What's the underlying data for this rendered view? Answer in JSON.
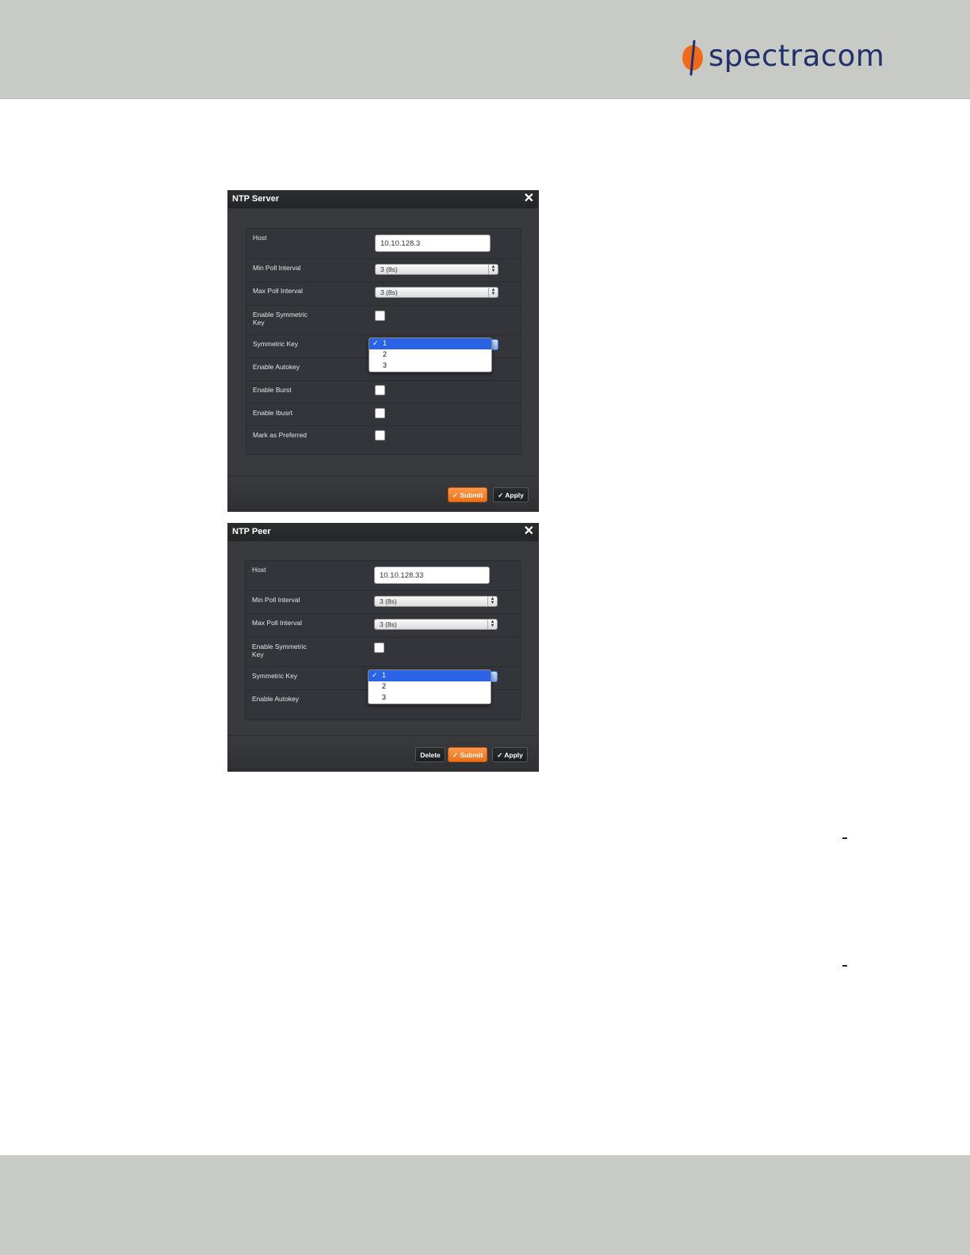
{
  "brand": {
    "name": "spectracom",
    "color": "#22306c",
    "accent": "#f06a1c"
  },
  "dialogs": {
    "server": {
      "title": "NTP Server",
      "host_label": "Host",
      "host_value": "10.10.128.3",
      "min_poll_label": "Min Poll Interval",
      "min_poll_value": "3 (8s)",
      "max_poll_label": "Max Poll Interval",
      "max_poll_value": "3 (8s)",
      "enable_sym_label": "Enable Symmetric Key",
      "sym_key_label": "Symmetric Key",
      "sym_key_options": [
        "1",
        "2",
        "3"
      ],
      "autokey_label": "Enable Autokey",
      "burst_label": "Enable Burst",
      "iburst_label": "Enable Ibusrt",
      "preferred_label": "Mark as Preferred",
      "submit_label": "Submit",
      "apply_label": "Apply"
    },
    "peer": {
      "title": "NTP Peer",
      "host_label": "Host",
      "host_value": "10.10.128.33",
      "min_poll_label": "Min Poll Interval",
      "min_poll_value": "3 (8s)",
      "max_poll_label": "Max Poll Interval",
      "max_poll_value": "3 (8s)",
      "enable_sym_label": "Enable Symmetric Key",
      "sym_key_label": "Symmetric Key",
      "sym_key_options": [
        "1",
        "2",
        "3"
      ],
      "autokey_label": "Enable Autokey",
      "delete_label": "Delete",
      "submit_label": "Submit",
      "apply_label": "Apply"
    }
  },
  "icons": {
    "close": "close-icon",
    "check": "checkmark-icon",
    "select_arrows": "updown-arrows-icon"
  }
}
